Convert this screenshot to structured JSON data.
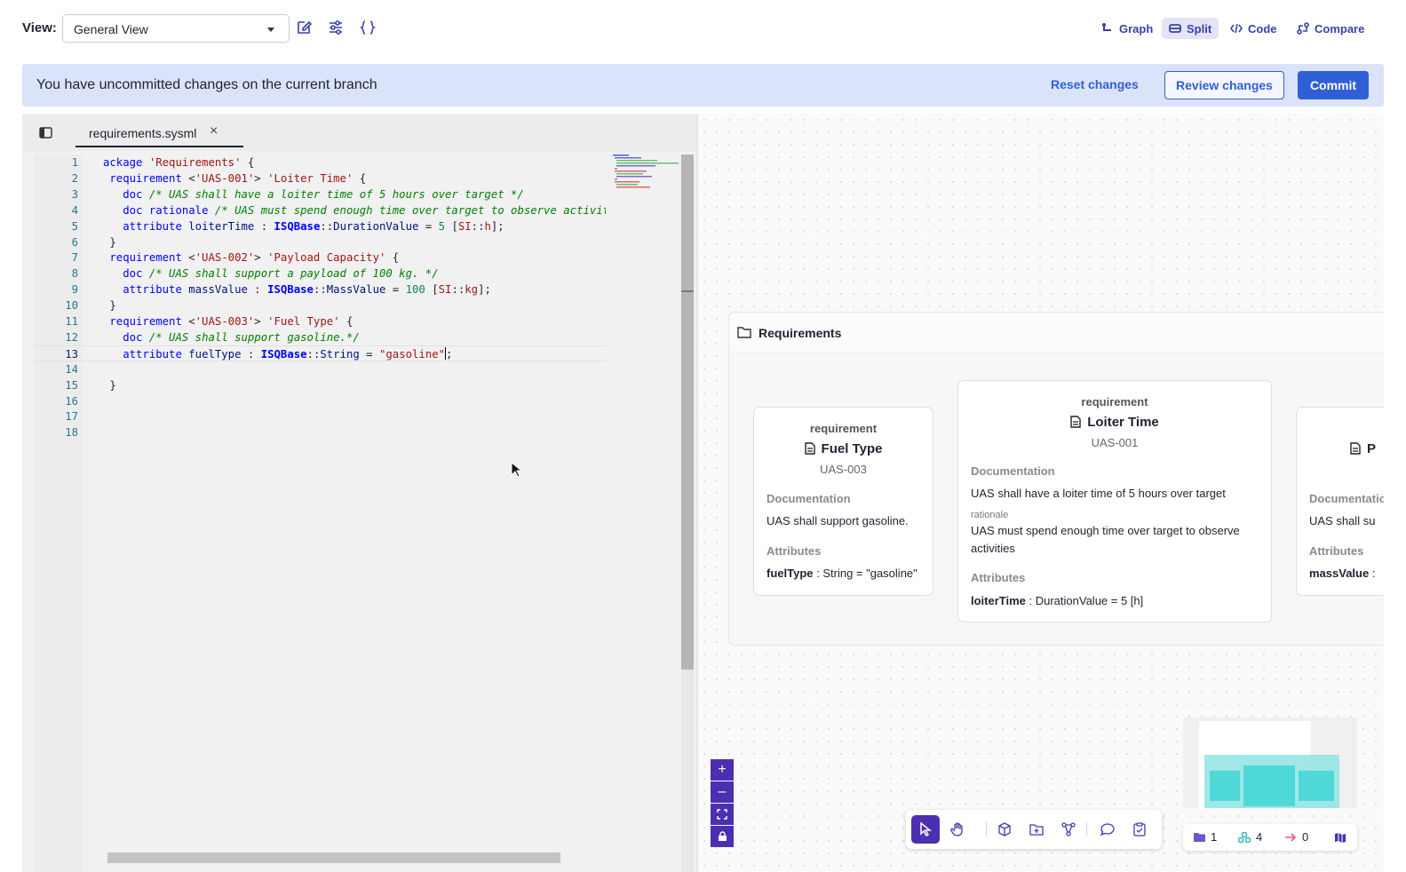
{
  "topbar": {
    "view_label": "View:",
    "view_value": "General View",
    "modes": [
      {
        "label": "Graph",
        "icon": "graph-icon"
      },
      {
        "label": "Split",
        "icon": "split-icon",
        "active": true
      },
      {
        "label": "Code",
        "icon": "code-icon"
      },
      {
        "label": "Compare",
        "icon": "compare-icon"
      }
    ]
  },
  "banner": {
    "message": "You have uncommitted changes on the current branch",
    "reset": "Reset changes",
    "review": "Review changes",
    "commit": "Commit"
  },
  "editor": {
    "tab_name": "requirements.sysml",
    "tab_close": "×",
    "current_line": 13,
    "lines": [
      "ackage 'Requirements' {",
      " requirement <'UAS-001'> 'Loiter Time' {",
      "   doc /* UAS shall have a loiter time of 5 hours over target */",
      "   doc rationale /* UAS must spend enough time over target to observe activitie",
      "   attribute loiterTime : ISQBase::DurationValue = 5 [SI::h];",
      " }",
      " requirement <'UAS-002'> 'Payload Capacity' {",
      "   doc /* UAS shall support a payload of 100 kg. */",
      "   attribute massValue : ISQBase::MassValue = 100 [SI::kg];",
      " }",
      " requirement <'UAS-003'> 'Fuel Type' {",
      "   doc /* UAS shall support gasoline.*/",
      "   attribute fuelType : ISQBase::String = \"gasoline\";",
      "",
      " }",
      "",
      "",
      ""
    ]
  },
  "diagram": {
    "package_title": "Requirements",
    "cards": [
      {
        "stereotype": "requirement",
        "name": "Fuel Type",
        "id": "UAS-003",
        "doc_label": "Documentation",
        "doc": "UAS shall support gasoline.",
        "attr_label": "Attributes",
        "attr_name": "fuelType",
        "attr_rest": " : String = \"gasoline\""
      },
      {
        "stereotype": "requirement",
        "name": "Loiter Time",
        "id": "UAS-001",
        "doc_label": "Documentation",
        "doc": "UAS shall have a loiter time of 5 hours over target",
        "rationale_label": "rationale",
        "rationale": "UAS must spend enough time over target to observe activities",
        "attr_label": "Attributes",
        "attr_name": "loiterTime",
        "attr_rest": " : DurationValue = 5 [h]"
      },
      {
        "name": "P",
        "doc_label": "Documentation",
        "doc": "UAS shall su",
        "attr_label": "Attributes",
        "attr_name": "massValue",
        "attr_rest": " :"
      }
    ],
    "zoom": {
      "in": "+",
      "out": "–"
    },
    "stats": [
      {
        "icon": "folder-icon",
        "value": "1",
        "color": "#6b57c9"
      },
      {
        "icon": "elements-icon",
        "value": "4",
        "color": "#2bb3c0"
      },
      {
        "icon": "arrow-right-icon",
        "value": "0",
        "color": "#e05a7a"
      }
    ]
  },
  "colors": {
    "accent": "#2f5fd6",
    "banner_bg": "#dbe3fb",
    "toolbar_purple": "#4b2fb0",
    "mode_text": "#3b3fa8",
    "minimap_teal": "#4fd8d8"
  }
}
